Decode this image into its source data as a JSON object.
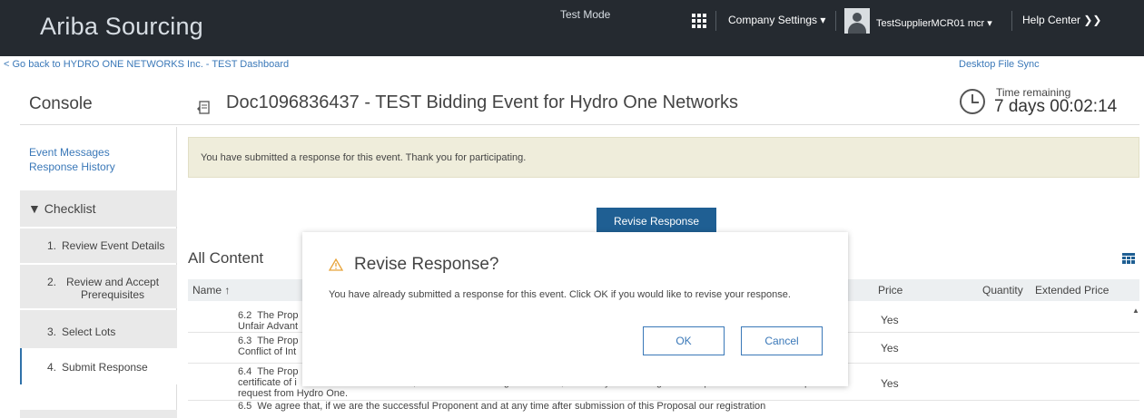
{
  "header": {
    "brand": "Ariba Sourcing",
    "test_mode": "Test Mode",
    "company_settings": "Company Settings ▾",
    "user": "TestSupplierMCR01 mcr ▾",
    "help_center": "Help Center ❯❯"
  },
  "subheader": {
    "back_link": "< Go back to HYDRO ONE NETWORKS Inc. - TEST Dashboard",
    "desktop_file_sync": "Desktop File Sync",
    "console": "Console",
    "doc_title": "Doc1096836437 - TEST Bidding Event for Hydro One Networks",
    "time_label": "Time remaining",
    "time_value": "7 days 00:02:14"
  },
  "sidebar": {
    "event_messages": "Event Messages",
    "response_history": "Response History",
    "checklist": "▼ Checklist",
    "items": [
      {
        "num": "1.",
        "label": "Review Event Details"
      },
      {
        "num": "2.",
        "label": "Review and Accept Prerequisites"
      },
      {
        "num": "3.",
        "label": "Select Lots"
      },
      {
        "num": "4.",
        "label": "Submit Response"
      }
    ]
  },
  "main": {
    "notice": "You have submitted a response for this event.  Thank you for participating.",
    "revise_button": "Revise Response",
    "all_content": "All Content",
    "columns": {
      "name": "Name ↑",
      "price": "Price",
      "quantity": "Quantity",
      "extended_price": "Extended Price"
    },
    "rows": [
      {
        "name": "6.2  The Prop\nUnfair Advant",
        "price": "Yes"
      },
      {
        "name": "6.3  The Prop\nConflict of Int",
        "price": "Yes"
      },
      {
        "name": "6.4  The Prop                                                                                                                                                    \ncertificate of i                                          , and other constating documents, etc at any time during the RFP process or thereafter upon\nrequest from Hydro One.",
        "price": "Yes"
      },
      {
        "name": "6.5  We agree that, if we are the successful Proponent and at any time after submission of this Proposal our registration",
        "price": ""
      }
    ]
  },
  "modal": {
    "title": "Revise Response?",
    "message": "You have already submitted a response for this event. Click OK if you would like to revise your response.",
    "ok": "OK",
    "cancel": "Cancel"
  }
}
